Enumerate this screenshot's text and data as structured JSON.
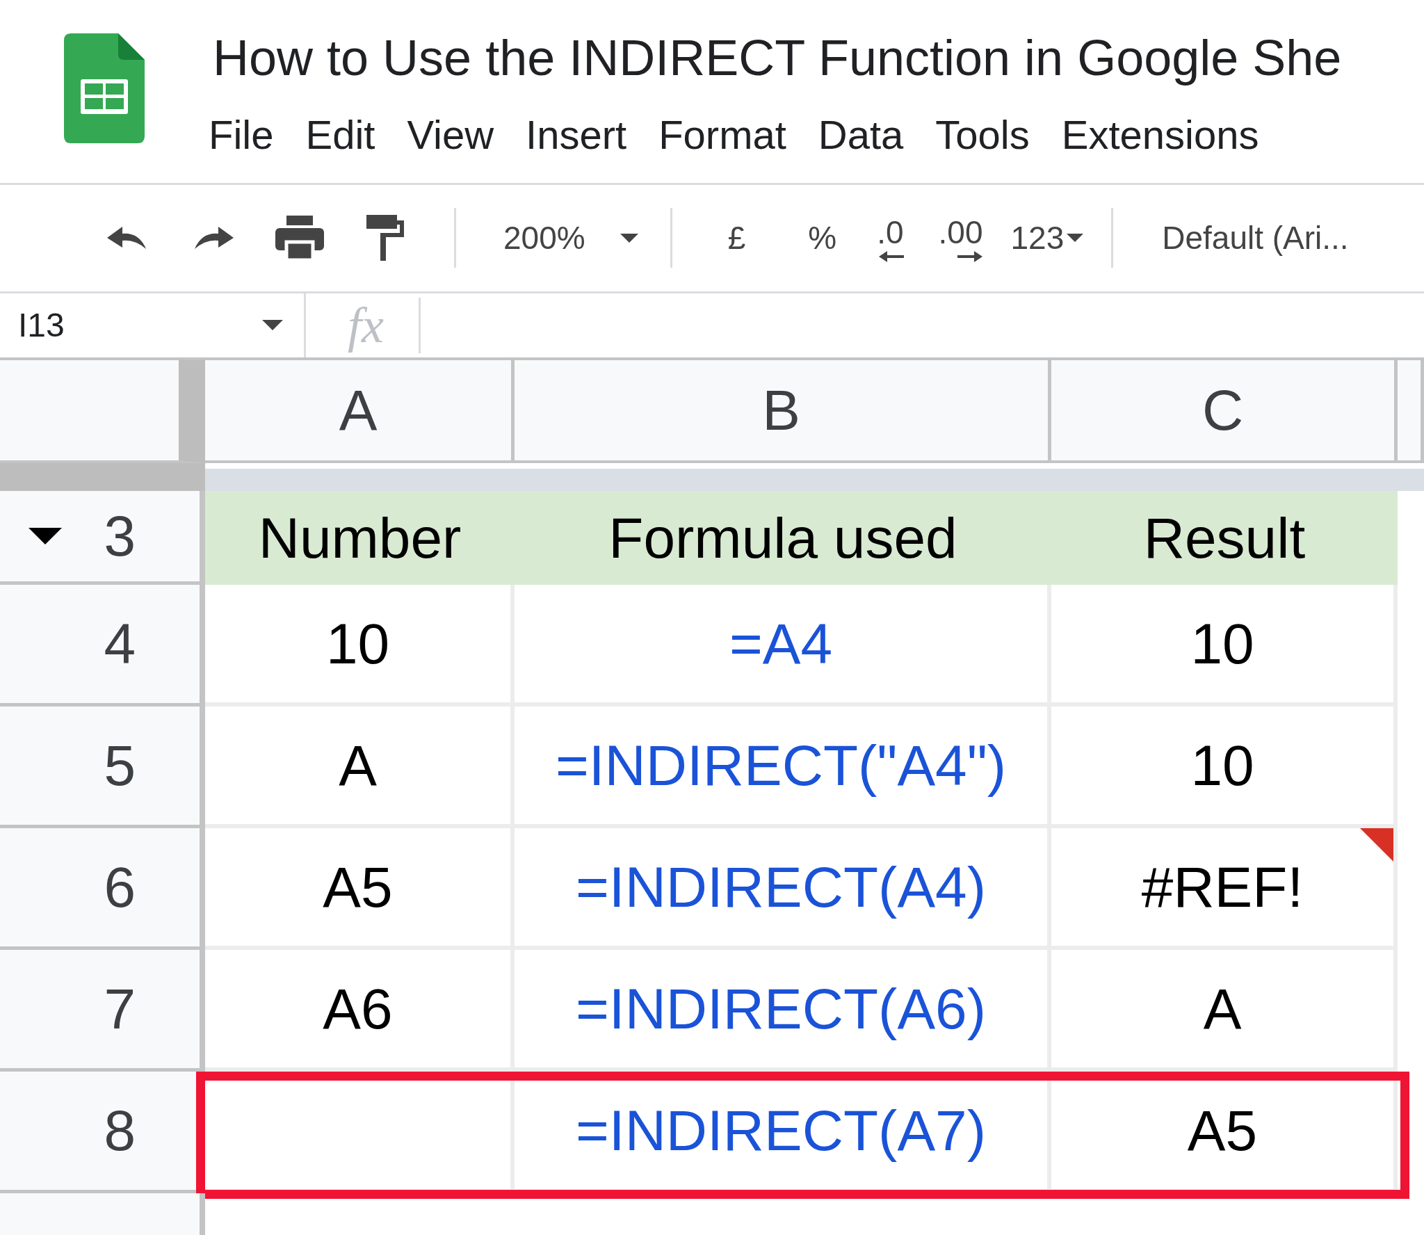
{
  "document": {
    "title": "How to Use the INDIRECT Function in Google She"
  },
  "menu": [
    "File",
    "Edit",
    "View",
    "Insert",
    "Format",
    "Data",
    "Tools",
    "Extensions"
  ],
  "toolbar": {
    "zoom": "200%",
    "currency": "£",
    "percent": "%",
    "decrease_decimals": ".0",
    "increase_decimals": ".00",
    "number_format": "123",
    "font": "Default (Ari..."
  },
  "name_box": "I13",
  "formula_bar": {
    "label": "fx"
  },
  "columns": [
    "A",
    "B",
    "C"
  ],
  "rows": [
    {
      "number": "3",
      "kind": "header",
      "collapsible": true,
      "highlighted": false,
      "cells": [
        {
          "text": "Number",
          "kind": "text",
          "error": false
        },
        {
          "text": "Formula used",
          "kind": "text",
          "error": false
        },
        {
          "text": "Result",
          "kind": "text",
          "error": false
        }
      ]
    },
    {
      "number": "4",
      "kind": "data",
      "collapsible": false,
      "highlighted": false,
      "cells": [
        {
          "text": "10",
          "kind": "text",
          "error": false
        },
        {
          "text": "=A4",
          "kind": "formula",
          "error": false
        },
        {
          "text": "10",
          "kind": "text",
          "error": false
        }
      ]
    },
    {
      "number": "5",
      "kind": "data",
      "collapsible": false,
      "highlighted": false,
      "cells": [
        {
          "text": "A",
          "kind": "text",
          "error": false
        },
        {
          "text": "=INDIRECT(\"A4\")",
          "kind": "formula",
          "error": false
        },
        {
          "text": "10",
          "kind": "text",
          "error": false
        }
      ]
    },
    {
      "number": "6",
      "kind": "data",
      "collapsible": false,
      "highlighted": false,
      "cells": [
        {
          "text": "A5",
          "kind": "text",
          "error": false
        },
        {
          "text": "=INDIRECT(A4)",
          "kind": "formula",
          "error": false
        },
        {
          "text": "#REF!",
          "kind": "text",
          "error": true
        }
      ]
    },
    {
      "number": "7",
      "kind": "data",
      "collapsible": false,
      "highlighted": false,
      "cells": [
        {
          "text": "A6",
          "kind": "text",
          "error": false
        },
        {
          "text": "=INDIRECT(A6)",
          "kind": "formula",
          "error": false
        },
        {
          "text": "A",
          "kind": "text",
          "error": false
        }
      ]
    },
    {
      "number": "8",
      "kind": "data",
      "collapsible": false,
      "highlighted": true,
      "cells": [
        {
          "kind": "text",
          "error": false
        },
        {
          "text": "=INDIRECT(A7)",
          "kind": "formula",
          "error": false
        },
        {
          "text": "A5",
          "kind": "text",
          "error": false
        }
      ]
    }
  ]
}
